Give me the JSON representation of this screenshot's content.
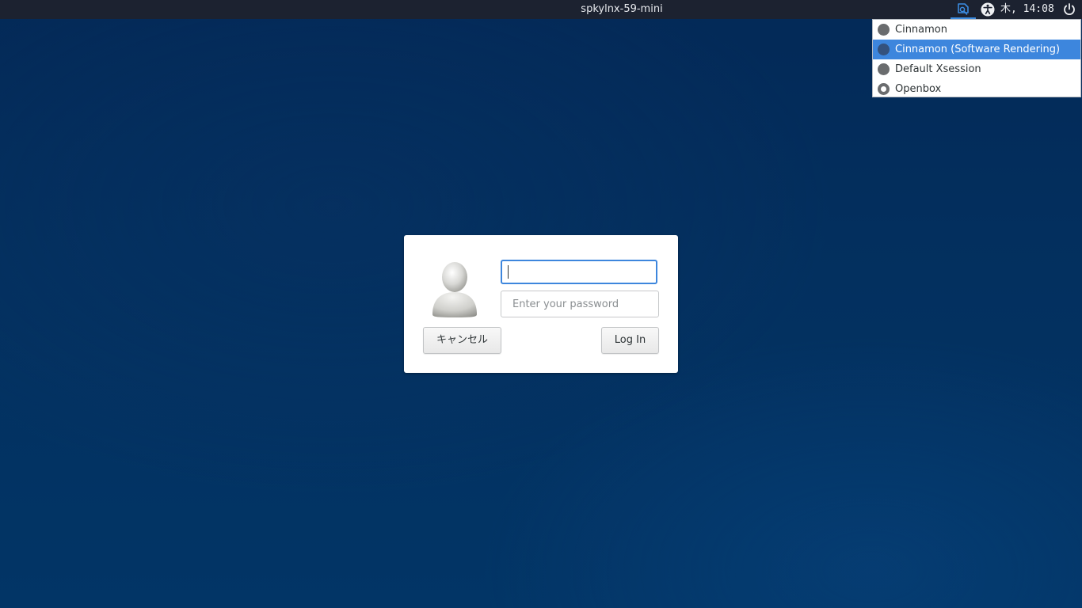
{
  "panel": {
    "hostname": "spkylnx-59-mini",
    "clock": "木, 14:08",
    "icons": {
      "session": "session-selector-icon",
      "accessibility": "accessibility-icon",
      "power": "power-icon"
    },
    "colors": {
      "panel_bg": "#1c2230",
      "accent": "#3d86dd"
    }
  },
  "session_menu": {
    "items": [
      {
        "label": "Cinnamon",
        "selected": false,
        "highlighted": false
      },
      {
        "label": "Cinnamon (Software Rendering)",
        "selected": false,
        "highlighted": true
      },
      {
        "label": "Default Xsession",
        "selected": false,
        "highlighted": false
      },
      {
        "label": "Openbox",
        "selected": true,
        "highlighted": false
      }
    ]
  },
  "login": {
    "avatar": "user-avatar-icon",
    "username_value": "",
    "password_placeholder": "Enter your password",
    "cancel_label": "キャンセル",
    "login_label": "Log In"
  }
}
